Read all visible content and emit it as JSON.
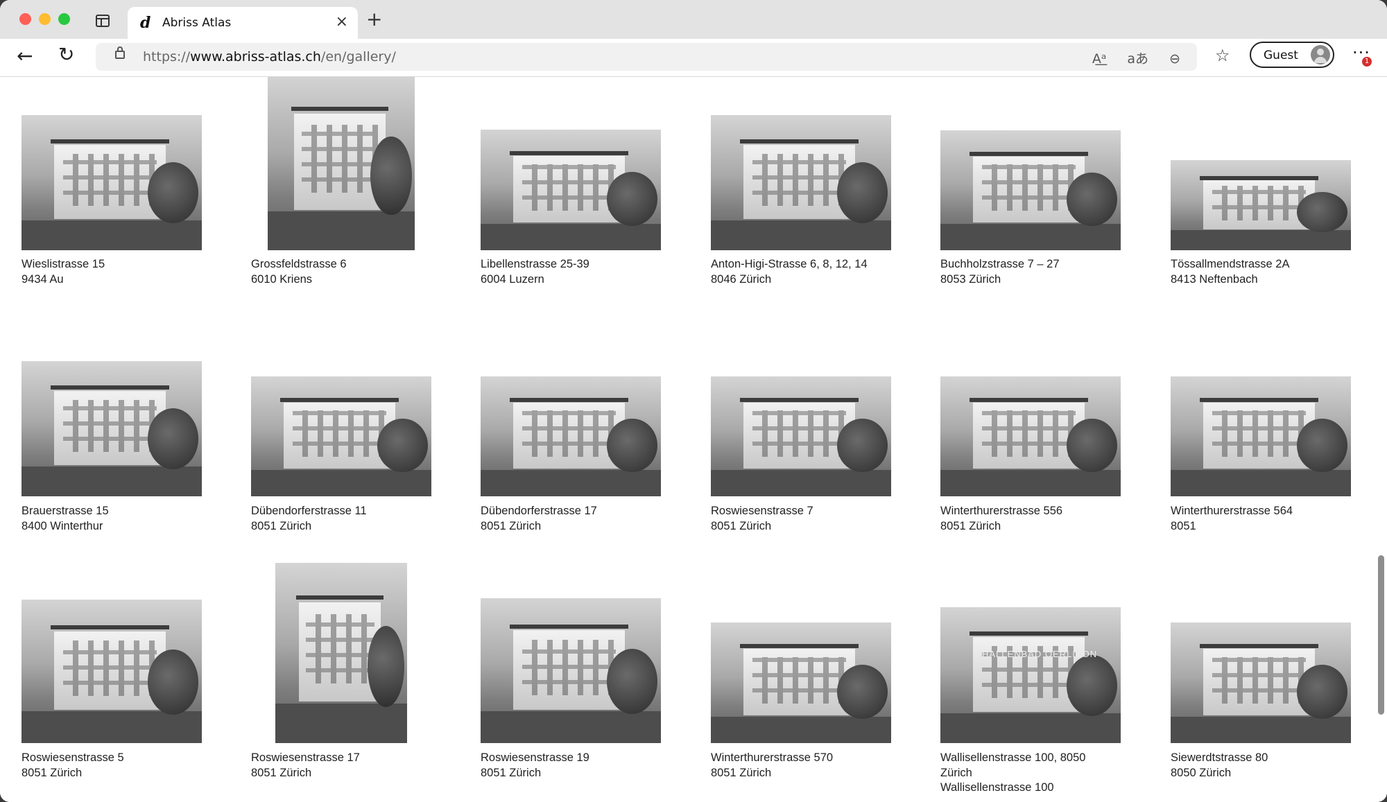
{
  "browser": {
    "tab_title": "Abriss Atlas",
    "tab_favicon": "d",
    "url_scheme": "https://",
    "url_host": "www.abriss-atlas.ch",
    "url_path": "/en/gallery/",
    "profile_label": "Guest",
    "notification_count": "1",
    "icons": [
      "sidebar-icon",
      "back-icon",
      "reload-icon",
      "lock-icon",
      "read-aloud-icon",
      "translate-icon",
      "zoom-out-icon",
      "favorites-icon",
      "avatar-icon",
      "more-icon"
    ]
  },
  "gallery": {
    "rows": [
      [
        {
          "street": "Wieslistrasse 15",
          "city": "9434 Au"
        },
        {
          "street": "Grossfeldstrasse 6",
          "city": "6010 Kriens"
        },
        {
          "street": "Libellenstrasse 25-39",
          "city": "6004 Luzern"
        },
        {
          "street": "Anton-Higi-Strasse 6, 8, 12, 14",
          "city": "8046 Zürich"
        },
        {
          "street": "Buchholzstrasse 7 – 27",
          "city": "8053 Zürich"
        },
        {
          "street": "Tössallmendstrasse 2A",
          "city": "8413 Neftenbach"
        }
      ],
      [
        {
          "street": "Brauerstrasse 15",
          "city": "8400 Winterthur"
        },
        {
          "street": "Dübendorferstrasse 11",
          "city": "8051 Zürich"
        },
        {
          "street": "Dübendorferstrasse 17",
          "city": "8051 Zürich"
        },
        {
          "street": "Roswiesenstrasse 7",
          "city": "8051 Zürich"
        },
        {
          "street": "Winterthurerstrasse 556",
          "city": "8051 Zürich"
        },
        {
          "street": "Winterthurerstrasse 564",
          "city": "8051"
        }
      ],
      [
        {
          "street": "Roswiesenstrasse 5",
          "city": "8051 Zürich"
        },
        {
          "street": "Roswiesenstrasse 17",
          "city": "8051 Zürich"
        },
        {
          "street": "Roswiesenstrasse 19",
          "city": "8051 Zürich"
        },
        {
          "street": "Winterthurerstrasse 570",
          "city": "8051 Zürich"
        },
        {
          "street": "Wallisellenstrasse 100, 8050",
          "city": "Zürich",
          "extra": "Wallisellenstrasse 100"
        },
        {
          "street": "Siewerdtstrasse 80",
          "city": "8050 Zürich"
        }
      ]
    ],
    "sign_text": "HALLENBAD OERLIKON"
  }
}
